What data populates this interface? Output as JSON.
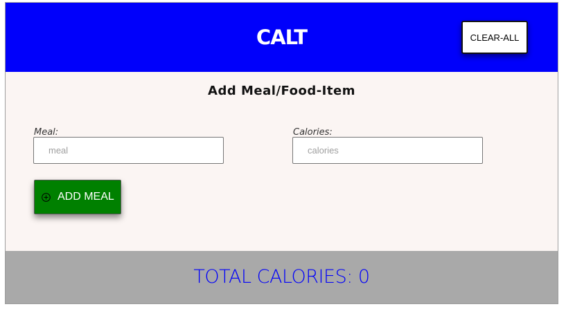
{
  "header": {
    "title": "CALT",
    "clear_all_label": "CLEAR-ALL"
  },
  "form": {
    "title": "Add Meal/Food-Item",
    "meal": {
      "label": "Meal:",
      "placeholder": "meal",
      "value": ""
    },
    "calories": {
      "label": "Calories:",
      "placeholder": "calories",
      "value": ""
    },
    "add_meal_label": "ADD MEAL",
    "add_meal_icon": "plus-circle-icon"
  },
  "footer": {
    "total_calories_text": "TOTAL CALORIES: 0"
  },
  "colors": {
    "header_bg": "#0000fb",
    "add_button": "#008000",
    "footer_bg": "#a9a9a9",
    "total_text": "#0000fb"
  }
}
